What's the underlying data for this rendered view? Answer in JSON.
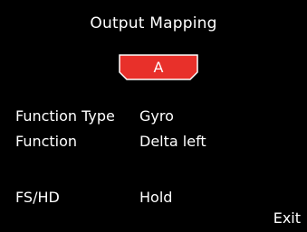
{
  "screen": {
    "title": "Output Mapping",
    "channel": "A",
    "rows": [
      {
        "label": "Function Type",
        "value": "Gyro"
      },
      {
        "label": "Function",
        "value": "Delta left"
      },
      {
        "label": "FS/HD",
        "value": "Hold"
      }
    ],
    "exit_label": "Exit"
  },
  "colors": {
    "background": "#000000",
    "text": "#ffffff",
    "channel_fill": "#e8302a",
    "channel_border": "#ffffff"
  }
}
